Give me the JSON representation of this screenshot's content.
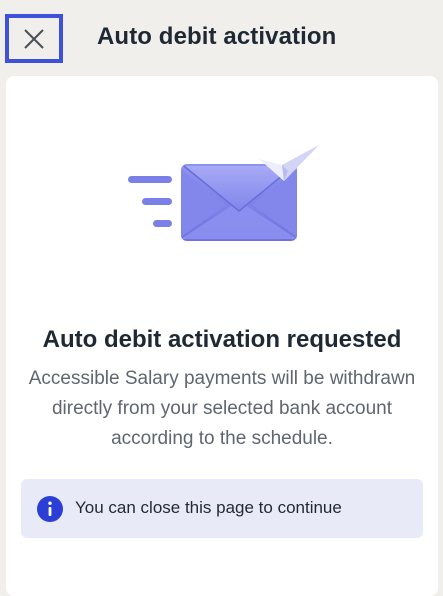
{
  "header": {
    "title": "Auto debit activation",
    "close_icon": "close-icon"
  },
  "content": {
    "illustration": "envelope-paper-plane-illustration",
    "title": "Auto debit activation requested",
    "description": "Accessible Salary payments will be withdrawn directly from your selected bank account according to the schedule."
  },
  "info": {
    "icon": "info-icon",
    "text": "You can close this page to continue"
  },
  "colors": {
    "accent": "#3f51d8",
    "envelope": "#7b7fe8",
    "info_bg": "#e8eaf7",
    "info_icon": "#2b3fd6"
  }
}
